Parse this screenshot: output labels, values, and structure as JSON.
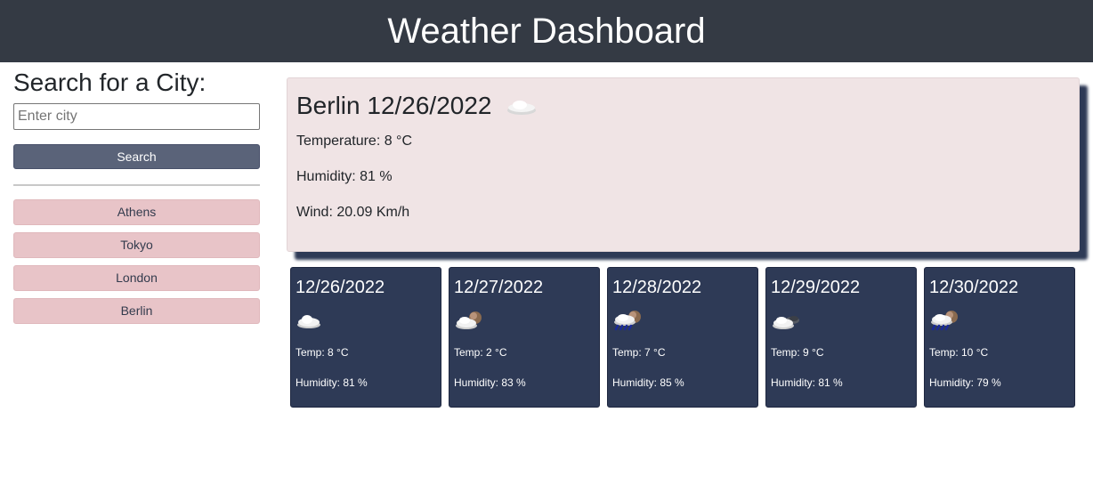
{
  "header": {
    "title": "Weather Dashboard"
  },
  "search": {
    "heading": "Search for a City:",
    "placeholder": "Enter city",
    "value": "",
    "button_label": "Search"
  },
  "history": [
    "Athens",
    "Tokyo",
    "London",
    "Berlin"
  ],
  "current": {
    "city_date": "Berlin 12/26/2022",
    "icon": "cloud-icon",
    "temperature": "Temperature: 8 °C",
    "humidity": "Humidity: 81 %",
    "wind": "Wind: 20.09 Km/h"
  },
  "forecast": [
    {
      "date": "12/26/2022",
      "icon": "cloud-icon",
      "temp": "Temp: 8 °C",
      "humidity": "Humidity: 81 %"
    },
    {
      "date": "12/27/2022",
      "icon": "cloud-moon-icon",
      "temp": "Temp: 2 °C",
      "humidity": "Humidity: 83 %"
    },
    {
      "date": "12/28/2022",
      "icon": "rain-moon-icon",
      "temp": "Temp: 7 °C",
      "humidity": "Humidity: 85 %"
    },
    {
      "date": "12/29/2022",
      "icon": "cloud-night-icon",
      "temp": "Temp: 9 °C",
      "humidity": "Humidity: 81 %"
    },
    {
      "date": "12/30/2022",
      "icon": "rain-moon-icon",
      "temp": "Temp: 10 °C",
      "humidity": "Humidity: 79 %"
    }
  ]
}
